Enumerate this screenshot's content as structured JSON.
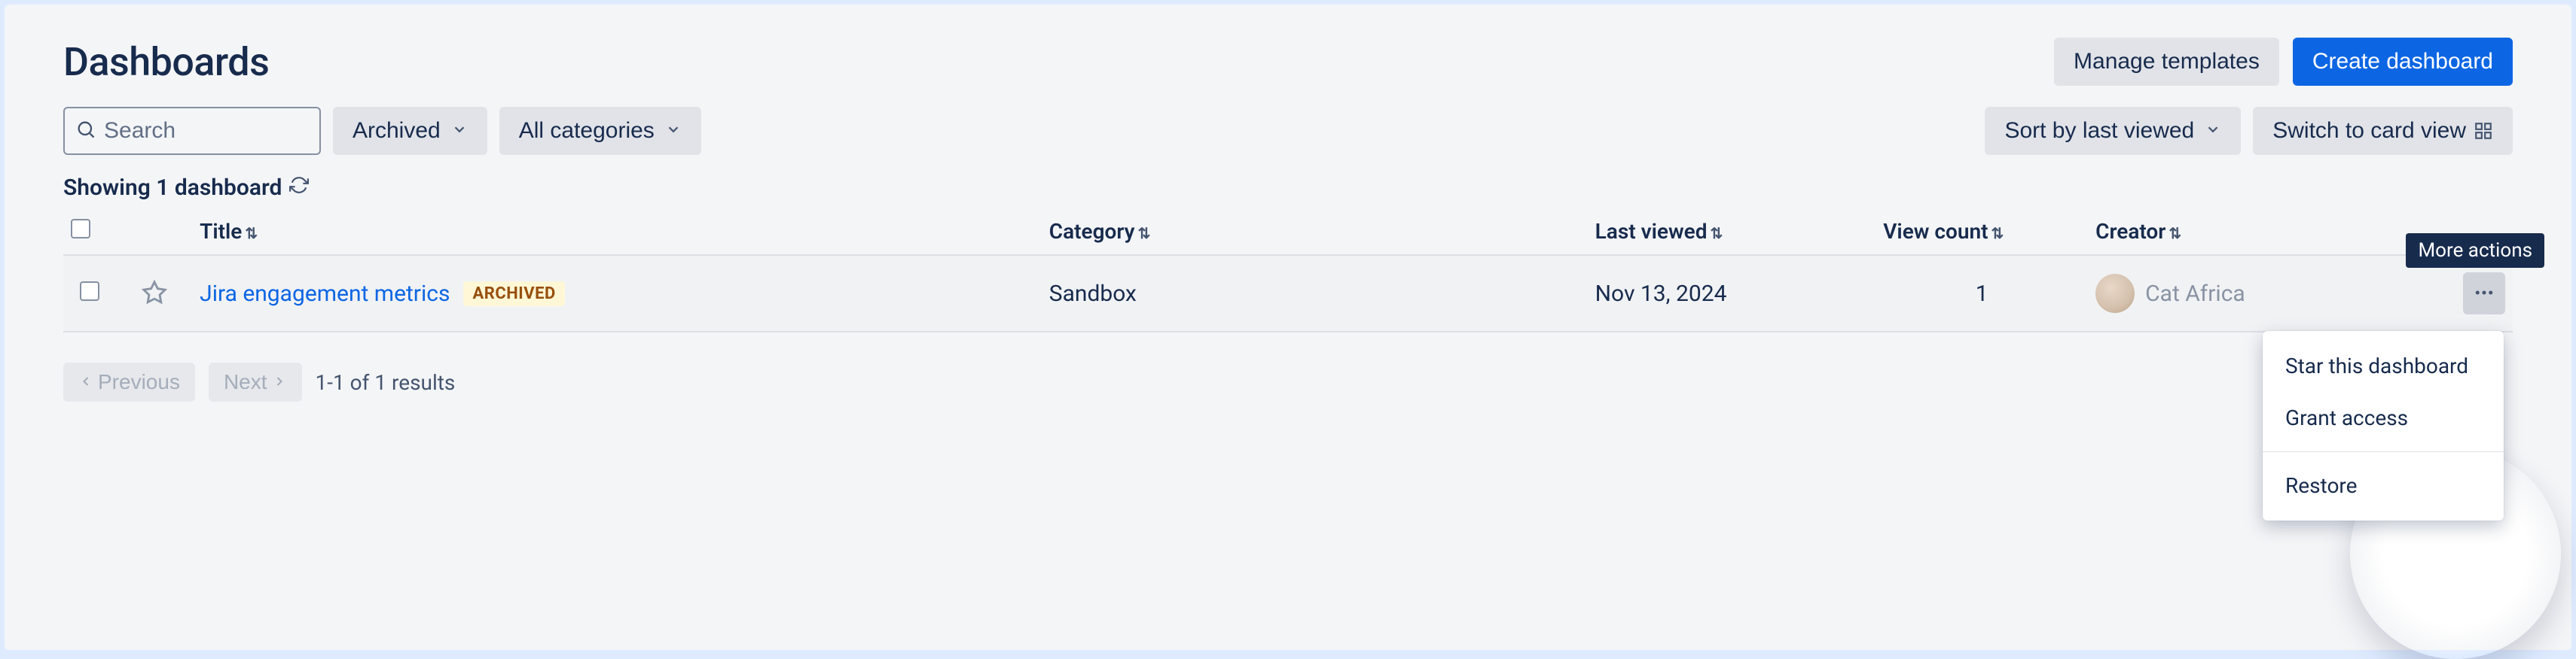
{
  "page": {
    "title": "Dashboards"
  },
  "header_actions": {
    "manage_templates": "Manage templates",
    "create_dashboard": "Create dashboard"
  },
  "filters": {
    "search_placeholder": "Search",
    "archived_label": "Archived",
    "categories_label": "All categories"
  },
  "sort": {
    "label": "Sort by last viewed",
    "view_toggle": "Switch to card view"
  },
  "count": {
    "text": "Showing 1 dashboard"
  },
  "columns": {
    "title": "Title",
    "category": "Category",
    "last_viewed": "Last viewed",
    "view_count": "View count",
    "creator": "Creator"
  },
  "rows": [
    {
      "title": "Jira engagement metrics",
      "badge": "ARCHIVED",
      "category": "Sandbox",
      "last_viewed": "Nov 13, 2024",
      "view_count": "1",
      "creator": "Cat Africa"
    }
  ],
  "pagination": {
    "previous": "Previous",
    "next": "Next",
    "summary": "1-1 of 1 results"
  },
  "tooltip": {
    "more_actions": "More actions"
  },
  "menu": {
    "star": "Star this dashboard",
    "grant": "Grant access",
    "restore": "Restore"
  }
}
